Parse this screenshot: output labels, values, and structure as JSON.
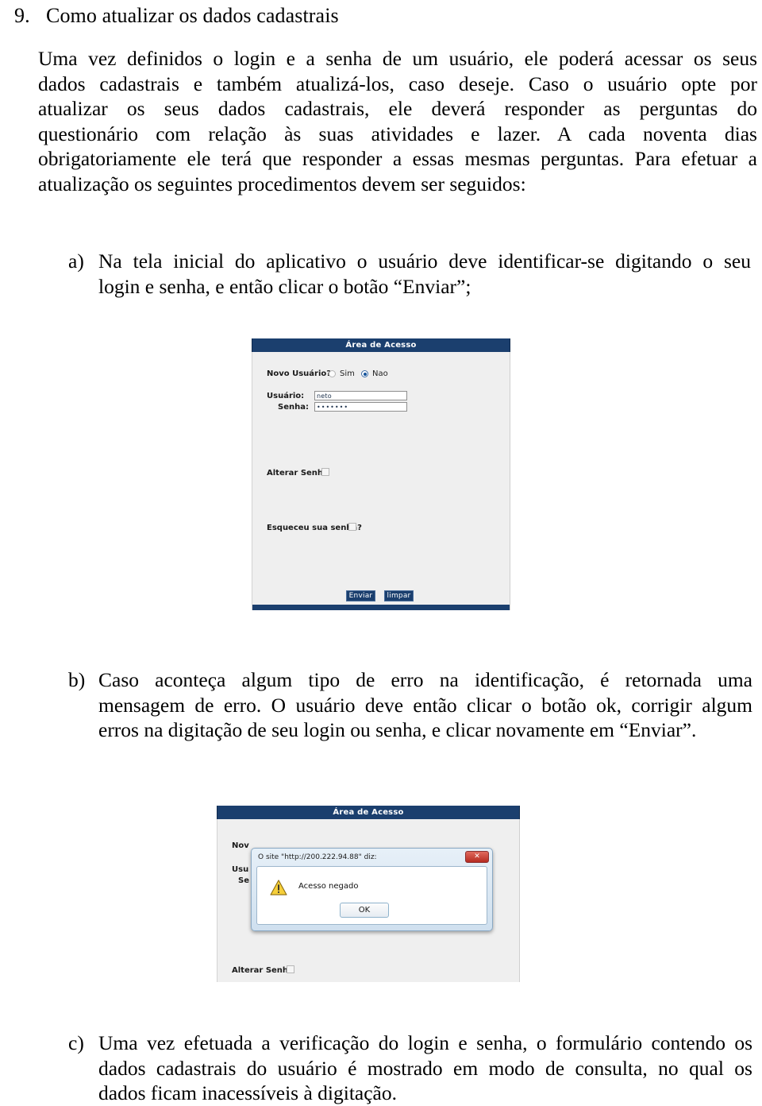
{
  "document": {
    "section_number": "9.",
    "heading": "Como atualizar os dados cadastrais",
    "intro_lines": [
      "Uma vez definidos o login e a senha de um usuário, ele poderá acessar os seus",
      "dados cadastrais e também atualizá-los, caso deseje.  Caso o usuário opte por",
      "atualizar os seus dados cadastrais, ele deverá responder as perguntas do",
      "questionário com relação às suas atividades e lazer. A cada noventa dias",
      "obrigatoriamente ele terá que responder a essas mesmas perguntas. Para efetuar a",
      "atualização os seguintes procedimentos devem ser seguidos:"
    ],
    "items": [
      {
        "marker": "a)",
        "lines": [
          "Na tela inicial do aplicativo o usuário deve identificar-se digitando o seu",
          "login e senha, e então clicar o botão “Enviar”;"
        ]
      },
      {
        "marker": "b)",
        "lines": [
          "Caso aconteça algum tipo de erro na identificação, é retornada uma",
          "mensagem de erro. O usuário deve então clicar o botão ok, corrigir algum",
          "erros na digitação de seu login ou senha, e clicar novamente em “Enviar”."
        ]
      },
      {
        "marker": "c)",
        "lines": [
          "Uma vez efetuada a verificação do login e senha, o formulário contendo os",
          "dados cadastrais do usuário é mostrado em modo de consulta, no qual os",
          "dados ficam inacessíveis à digitação."
        ]
      }
    ]
  },
  "login_screenshot": {
    "title": "Área de Acesso",
    "new_user_label": "Novo Usuário?",
    "radio_yes_label": "Sim",
    "radio_no_label": "Nao",
    "radio_selected": "Nao",
    "user_label": "Usuário:",
    "user_value": "neto",
    "password_label": "Senha:",
    "password_value": "•••••••",
    "change_password_label": "Alterar Senha",
    "forgot_password_label": "Esqueceu sua senha?",
    "submit_label": "Enviar",
    "clear_label": "limpar",
    "colors": {
      "titlebar": "#1b3f6e",
      "background": "#efefef",
      "button": "#1b3f6e"
    }
  },
  "error_screenshot": {
    "title": "Área de Acesso",
    "partial_new_user_label": "Nov",
    "partial_user_label": "Usu",
    "partial_password_label": "Se",
    "change_password_label": "Alterar Senha",
    "dialog": {
      "title": "O site \"http://200.222.94.88\" diz:",
      "message": "Acesso negado",
      "ok_label": "OK",
      "close_label": "✕",
      "close_color": "#b62b21"
    }
  }
}
